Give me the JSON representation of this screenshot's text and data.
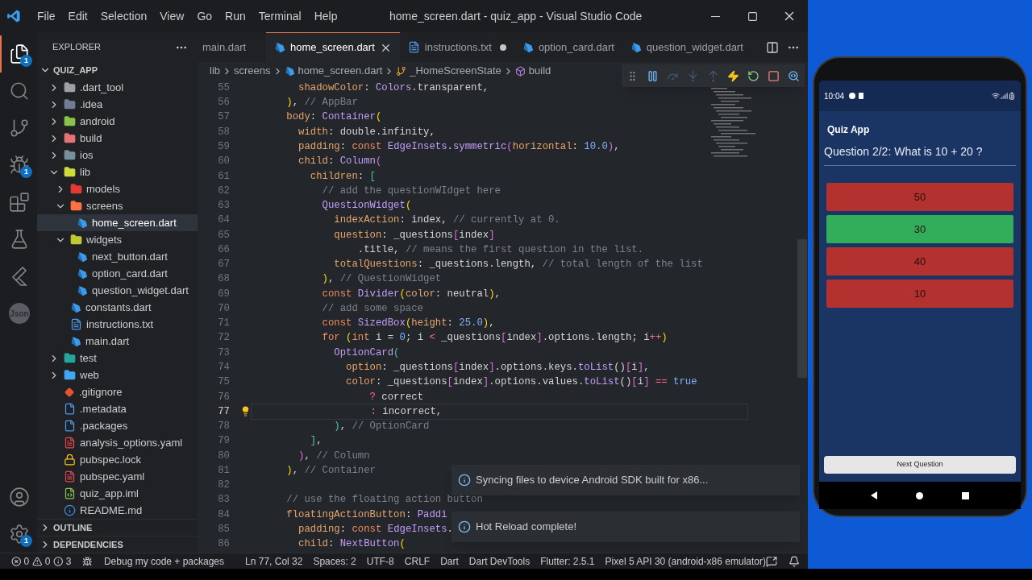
{
  "window": {
    "title": "home_screen.dart - quiz_app - Visual Studio Code"
  },
  "menu": [
    "File",
    "Edit",
    "Selection",
    "View",
    "Go",
    "Run",
    "Terminal",
    "Help"
  ],
  "activity_bar": [
    {
      "kind": "explorer",
      "selected": true,
      "badge": "1"
    },
    {
      "kind": "search",
      "selected": false
    },
    {
      "kind": "source_control",
      "selected": false
    },
    {
      "kind": "debug",
      "selected": false,
      "badge": "1"
    },
    {
      "kind": "extensions",
      "selected": false
    },
    {
      "kind": "testing",
      "selected": false
    },
    {
      "kind": "flutter",
      "selected": false
    },
    {
      "kind": "json",
      "selected": false,
      "label": "Json"
    },
    {
      "kind": "accounts",
      "selected": false
    },
    {
      "kind": "manage",
      "selected": false,
      "badge": "1"
    }
  ],
  "sidebar": {
    "title": "EXPLORER",
    "root": {
      "label": "QUIZ_APP",
      "expanded": true
    },
    "items": [
      {
        "kind": "folder",
        "label": ".dart_tool",
        "color": "#9aa0a6",
        "expanded": false,
        "selected": false
      },
      {
        "kind": "folder",
        "label": ".idea",
        "color": "#6f7e96",
        "expanded": false,
        "selected": false
      },
      {
        "kind": "folder",
        "label": "android",
        "color": "#8bc34a",
        "expanded": false,
        "selected": false
      },
      {
        "kind": "folder",
        "label": "build",
        "color": "#e57373",
        "expanded": false,
        "selected": false
      },
      {
        "kind": "folder",
        "label": "ios",
        "color": "#78909c",
        "expanded": false,
        "selected": false
      },
      {
        "kind": "folder",
        "label": "lib",
        "color": "#cddc39",
        "expanded": true,
        "selected": false,
        "children": [
          {
            "kind": "folder",
            "label": "models",
            "color": "#e53935",
            "expanded": false,
            "selected": false
          },
          {
            "kind": "folder",
            "label": "screens",
            "color": "#ff7043",
            "expanded": true,
            "selected": false,
            "children": [
              {
                "kind": "dart",
                "label": "home_screen.dart",
                "selected": true
              }
            ]
          },
          {
            "kind": "folder",
            "label": "widgets",
            "color": "#c0ca33",
            "expanded": true,
            "selected": false,
            "children": [
              {
                "kind": "dart",
                "label": "next_button.dart",
                "selected": false
              },
              {
                "kind": "dart",
                "label": "option_card.dart",
                "selected": false
              },
              {
                "kind": "dart",
                "label": "question_widget.dart",
                "selected": false
              }
            ]
          },
          {
            "kind": "dart",
            "label": "constants.dart",
            "selected": false
          },
          {
            "kind": "txt",
            "label": "instructions.txt",
            "selected": false
          },
          {
            "kind": "dart",
            "label": "main.dart",
            "selected": false
          }
        ]
      },
      {
        "kind": "folder",
        "label": "test",
        "color": "#26a69a",
        "expanded": false,
        "selected": false
      },
      {
        "kind": "folder",
        "label": "web",
        "color": "#42a5f5",
        "expanded": false,
        "selected": false
      },
      {
        "kind": "git",
        "label": ".gitignore",
        "selected": false
      },
      {
        "kind": "doc",
        "label": ".metadata",
        "selected": false
      },
      {
        "kind": "doc",
        "label": ".packages",
        "selected": false
      },
      {
        "kind": "yaml",
        "label": "analysis_options.yaml",
        "selected": false
      },
      {
        "kind": "lock",
        "label": "pubspec.lock",
        "selected": false
      },
      {
        "kind": "yaml",
        "label": "pubspec.yaml",
        "selected": false
      },
      {
        "kind": "iml",
        "label": "quiz_app.iml",
        "selected": false
      },
      {
        "kind": "info",
        "label": "README.md",
        "selected": false
      }
    ],
    "sections": [
      {
        "label": "OUTLINE",
        "expanded": false
      },
      {
        "label": "DEPENDENCIES",
        "expanded": false
      }
    ]
  },
  "tabs": [
    {
      "label": "main.dart",
      "kind": "clipped",
      "selected": false,
      "modified": false
    },
    {
      "label": "home_screen.dart",
      "kind": "dart",
      "selected": true,
      "modified": false
    },
    {
      "label": "instructions.txt",
      "kind": "txt",
      "selected": false,
      "modified": true
    },
    {
      "label": "option_card.dart",
      "kind": "dart",
      "selected": false,
      "modified": false
    },
    {
      "label": "question_widget.dart",
      "kind": "dart",
      "selected": false,
      "modified": false
    }
  ],
  "breadcrumbs": [
    {
      "label": "lib",
      "kind": "folder"
    },
    {
      "label": "screens",
      "kind": "folder"
    },
    {
      "label": "home_screen.dart",
      "kind": "dart"
    },
    {
      "label": "_HomeScreenState",
      "kind": "class"
    },
    {
      "label": "build",
      "kind": "method"
    }
  ],
  "debug_toolbar": [
    {
      "kind": "grip",
      "disabled": false
    },
    {
      "kind": "pause",
      "disabled": false
    },
    {
      "kind": "step_over",
      "disabled": true
    },
    {
      "kind": "step_into",
      "disabled": true
    },
    {
      "kind": "step_out",
      "disabled": true
    },
    {
      "kind": "hot_reload",
      "disabled": false
    },
    {
      "kind": "restart",
      "disabled": false
    },
    {
      "kind": "stop",
      "disabled": false
    },
    {
      "kind": "devtools",
      "disabled": false
    }
  ],
  "code": [
    {
      "number": "55",
      "current": false,
      "tokens": [
        {
          "kind": "p",
          "text": "        shadowColor"
        },
        {
          "kind": "t",
          "text": ": "
        },
        {
          "kind": "c",
          "text": "Colors"
        },
        {
          "kind": "t",
          "text": ".transparent,"
        }
      ]
    },
    {
      "number": "56",
      "current": false,
      "tokens": [
        {
          "kind": "b",
          "text": "      )"
        },
        {
          "kind": "t",
          "text": ", "
        },
        {
          "kind": "m",
          "text": "// AppBar"
        }
      ]
    },
    {
      "number": "57",
      "current": false,
      "tokens": [
        {
          "kind": "p",
          "text": "      body"
        },
        {
          "kind": "t",
          "text": ": "
        },
        {
          "kind": "c",
          "text": "Container"
        },
        {
          "kind": "b",
          "text": "("
        }
      ]
    },
    {
      "number": "58",
      "current": false,
      "tokens": [
        {
          "kind": "p",
          "text": "        width"
        },
        {
          "kind": "t",
          "text": ": double.infinity,"
        }
      ]
    },
    {
      "number": "59",
      "current": false,
      "tokens": [
        {
          "kind": "p",
          "text": "        padding"
        },
        {
          "kind": "t",
          "text": ": "
        },
        {
          "kind": "k",
          "text": "const "
        },
        {
          "kind": "c",
          "text": "EdgeInsets"
        },
        {
          "kind": "t",
          "text": "."
        },
        {
          "kind": "c",
          "text": "symmetric"
        },
        {
          "kind": "v",
          "text": "("
        },
        {
          "kind": "p",
          "text": "horizontal"
        },
        {
          "kind": "t",
          "text": ": "
        },
        {
          "kind": "n",
          "text": "10.0"
        },
        {
          "kind": "v",
          "text": ")"
        },
        {
          "kind": "t",
          "text": ","
        }
      ]
    },
    {
      "number": "60",
      "current": false,
      "tokens": [
        {
          "kind": "p",
          "text": "        child"
        },
        {
          "kind": "t",
          "text": ": "
        },
        {
          "kind": "c",
          "text": "Column"
        },
        {
          "kind": "v",
          "text": "("
        }
      ]
    },
    {
      "number": "61",
      "current": false,
      "tokens": [
        {
          "kind": "p",
          "text": "          children"
        },
        {
          "kind": "t",
          "text": ": "
        },
        {
          "kind": "g",
          "text": "["
        }
      ]
    },
    {
      "number": "62",
      "current": false,
      "tokens": [
        {
          "kind": "m",
          "text": "            // add the questionWIdget here"
        }
      ]
    },
    {
      "number": "63",
      "current": false,
      "tokens": [
        {
          "kind": "c",
          "text": "            QuestionWidget"
        },
        {
          "kind": "b",
          "text": "("
        }
      ]
    },
    {
      "number": "64",
      "current": false,
      "tokens": [
        {
          "kind": "p",
          "text": "              indexAction"
        },
        {
          "kind": "t",
          "text": ": index, "
        },
        {
          "kind": "m",
          "text": "// currently at 0."
        }
      ]
    },
    {
      "number": "65",
      "current": false,
      "tokens": [
        {
          "kind": "p",
          "text": "              question"
        },
        {
          "kind": "t",
          "text": ": _questions"
        },
        {
          "kind": "v",
          "text": "["
        },
        {
          "kind": "t",
          "text": "index"
        },
        {
          "kind": "v",
          "text": "]"
        }
      ]
    },
    {
      "number": "66",
      "current": false,
      "tokens": [
        {
          "kind": "t",
          "text": "                  .title, "
        },
        {
          "kind": "m",
          "text": "// means the first question in the list."
        }
      ]
    },
    {
      "number": "67",
      "current": false,
      "tokens": [
        {
          "kind": "p",
          "text": "              totalQuestions"
        },
        {
          "kind": "t",
          "text": ": _questions.length, "
        },
        {
          "kind": "m",
          "text": "// total length of the list"
        }
      ]
    },
    {
      "number": "68",
      "current": false,
      "tokens": [
        {
          "kind": "b",
          "text": "            )"
        },
        {
          "kind": "t",
          "text": ", "
        },
        {
          "kind": "m",
          "text": "// QuestionWidget"
        }
      ]
    },
    {
      "number": "69",
      "current": false,
      "tokens": [
        {
          "kind": "k",
          "text": "            const "
        },
        {
          "kind": "c",
          "text": "Divider"
        },
        {
          "kind": "b",
          "text": "("
        },
        {
          "kind": "p",
          "text": "color"
        },
        {
          "kind": "t",
          "text": ": neutral"
        },
        {
          "kind": "b",
          "text": ")"
        },
        {
          "kind": "t",
          "text": ","
        }
      ]
    },
    {
      "number": "70",
      "current": false,
      "tokens": [
        {
          "kind": "m",
          "text": "            // add some space"
        }
      ]
    },
    {
      "number": "71",
      "current": false,
      "tokens": [
        {
          "kind": "k",
          "text": "            const "
        },
        {
          "kind": "c",
          "text": "SizedBox"
        },
        {
          "kind": "b",
          "text": "("
        },
        {
          "kind": "p",
          "text": "height"
        },
        {
          "kind": "t",
          "text": ": "
        },
        {
          "kind": "n",
          "text": "25.0"
        },
        {
          "kind": "b",
          "text": ")"
        },
        {
          "kind": "t",
          "text": ","
        }
      ]
    },
    {
      "number": "72",
      "current": false,
      "tokens": [
        {
          "kind": "k",
          "text": "            for "
        },
        {
          "kind": "b",
          "text": "("
        },
        {
          "kind": "k",
          "text": "int "
        },
        {
          "kind": "t",
          "text": "i = "
        },
        {
          "kind": "n",
          "text": "0"
        },
        {
          "kind": "t",
          "text": "; i "
        },
        {
          "kind": "o",
          "text": "<"
        },
        {
          "kind": "t",
          "text": " _questions"
        },
        {
          "kind": "v",
          "text": "["
        },
        {
          "kind": "t",
          "text": "index"
        },
        {
          "kind": "v",
          "text": "]"
        },
        {
          "kind": "t",
          "text": ".options.length; i"
        },
        {
          "kind": "o",
          "text": "++"
        },
        {
          "kind": "b",
          "text": ")"
        }
      ]
    },
    {
      "number": "73",
      "current": false,
      "tokens": [
        {
          "kind": "c",
          "text": "              OptionCard"
        },
        {
          "kind": "g",
          "text": "("
        }
      ]
    },
    {
      "number": "74",
      "current": false,
      "tokens": [
        {
          "kind": "p",
          "text": "                option"
        },
        {
          "kind": "t",
          "text": ": _questions"
        },
        {
          "kind": "v",
          "text": "["
        },
        {
          "kind": "t",
          "text": "index"
        },
        {
          "kind": "v",
          "text": "]"
        },
        {
          "kind": "t",
          "text": ".options.keys."
        },
        {
          "kind": "c",
          "text": "toList"
        },
        {
          "kind": "t",
          "text": "()"
        },
        {
          "kind": "v",
          "text": "["
        },
        {
          "kind": "t",
          "text": "i"
        },
        {
          "kind": "v",
          "text": "]"
        },
        {
          "kind": "t",
          "text": ","
        }
      ]
    },
    {
      "number": "75",
      "current": false,
      "tokens": [
        {
          "kind": "p",
          "text": "                color"
        },
        {
          "kind": "t",
          "text": ": _questions"
        },
        {
          "kind": "v",
          "text": "["
        },
        {
          "kind": "t",
          "text": "index"
        },
        {
          "kind": "v",
          "text": "]"
        },
        {
          "kind": "t",
          "text": ".options.values."
        },
        {
          "kind": "c",
          "text": "toList"
        },
        {
          "kind": "t",
          "text": "()"
        },
        {
          "kind": "v",
          "text": "["
        },
        {
          "kind": "t",
          "text": "i"
        },
        {
          "kind": "v",
          "text": "]"
        },
        {
          "kind": "o",
          "text": " == "
        },
        {
          "kind": "n",
          "text": "true"
        }
      ]
    },
    {
      "number": "76",
      "current": false,
      "tokens": [
        {
          "kind": "o",
          "text": "                    ? "
        },
        {
          "kind": "t",
          "text": "correct"
        }
      ]
    },
    {
      "number": "77",
      "current": true,
      "tokens": [
        {
          "kind": "o",
          "text": "                    : "
        },
        {
          "kind": "t",
          "text": "incorrect,"
        }
      ]
    },
    {
      "number": "78",
      "current": false,
      "tokens": [
        {
          "kind": "g",
          "text": "              )"
        },
        {
          "kind": "t",
          "text": ", "
        },
        {
          "kind": "m",
          "text": "// OptionCard"
        }
      ]
    },
    {
      "number": "79",
      "current": false,
      "tokens": [
        {
          "kind": "g",
          "text": "          ]"
        },
        {
          "kind": "t",
          "text": ","
        }
      ]
    },
    {
      "number": "80",
      "current": false,
      "tokens": [
        {
          "kind": "v",
          "text": "        )"
        },
        {
          "kind": "t",
          "text": ", "
        },
        {
          "kind": "m",
          "text": "// Column"
        }
      ]
    },
    {
      "number": "81",
      "current": false,
      "tokens": [
        {
          "kind": "b",
          "text": "      )"
        },
        {
          "kind": "t",
          "text": ", "
        },
        {
          "kind": "m",
          "text": "// Container"
        }
      ]
    },
    {
      "number": "82",
      "current": false
    },
    {
      "number": "83",
      "current": false,
      "tokens": [
        {
          "kind": "m",
          "text": "      // use the floating action button"
        }
      ]
    },
    {
      "number": "84",
      "current": false,
      "tokens": [
        {
          "kind": "p",
          "text": "      floatingActionButton"
        },
        {
          "kind": "t",
          "text": ": "
        },
        {
          "kind": "c",
          "text": "Paddi"
        }
      ]
    },
    {
      "number": "85",
      "current": false,
      "tokens": [
        {
          "kind": "p",
          "text": "        padding"
        },
        {
          "kind": "t",
          "text": ": "
        },
        {
          "kind": "k",
          "text": "const "
        },
        {
          "kind": "c",
          "text": "EdgeInsets"
        },
        {
          "kind": "t",
          "text": "."
        }
      ]
    },
    {
      "number": "86",
      "current": false,
      "tokens": [
        {
          "kind": "p",
          "text": "        child"
        },
        {
          "kind": "t",
          "text": ": "
        },
        {
          "kind": "c",
          "text": "NextButton"
        },
        {
          "kind": "b",
          "text": "("
        }
      ]
    }
  ],
  "notifications": [
    "Syncing files to device Android SDK built for x86...",
    "Hot Reload complete!"
  ],
  "status_bar": {
    "errors": "0",
    "warnings": "0",
    "infos": "3",
    "debug": "Debug my code + packages",
    "items": [
      "Ln 77, Col 32",
      "Spaces: 2",
      "UTF-8",
      "CRLF",
      "Dart",
      "Dart DevTools",
      "Flutter: 2.5.1",
      "Pixel 5 API 30 (android-x86 emulator)"
    ]
  },
  "phone": {
    "time": "10:04",
    "app_title": "Quiz App",
    "question": "Question 2/2: What is 10 + 20 ?",
    "options": [
      {
        "text": "50",
        "correct": false
      },
      {
        "text": "30",
        "correct": true
      },
      {
        "text": "40",
        "correct": false
      },
      {
        "text": "10",
        "correct": false
      }
    ],
    "next_button": "Next Question"
  }
}
